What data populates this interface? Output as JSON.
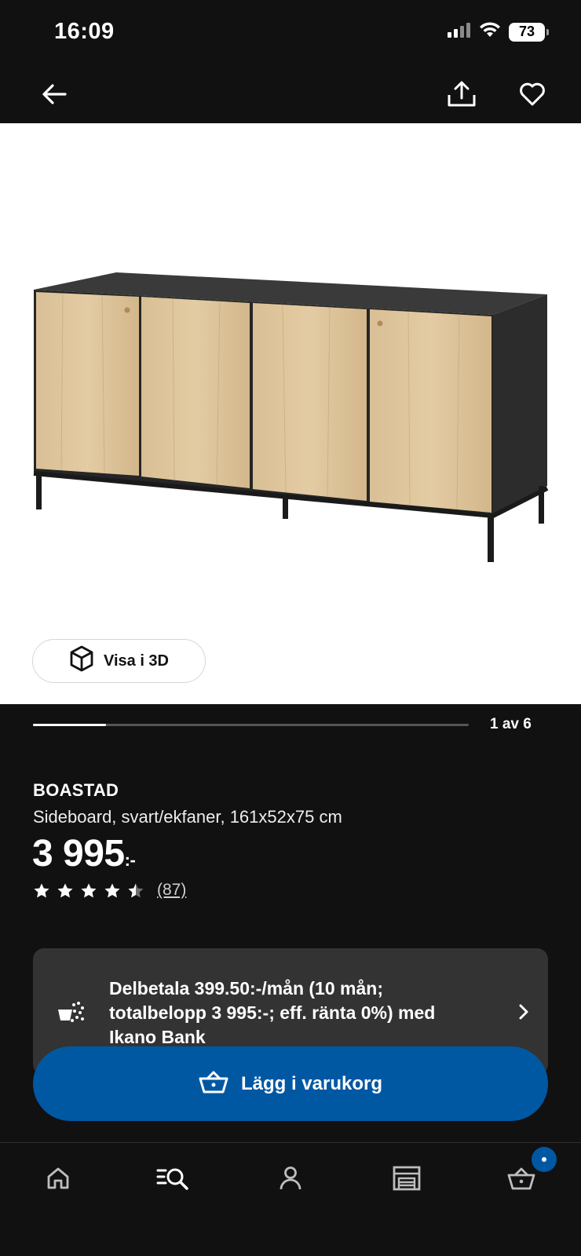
{
  "status_bar": {
    "time": "16:09",
    "battery": "73",
    "icons": [
      "cellular-signal-icon",
      "wifi-icon",
      "battery-icon"
    ]
  },
  "top_nav": {
    "icons": [
      "back-arrow-icon",
      "share-icon",
      "heart-icon"
    ]
  },
  "product_image": {
    "view_3d_label": "Visa i 3D"
  },
  "carousel": {
    "counter": "1 av 6",
    "current": 1,
    "total": 6
  },
  "product": {
    "name": "BOASTAD",
    "description": "Sideboard, svart/ekfaner, 161x52x75 cm",
    "price": "3 995",
    "price_suffix": ":-",
    "rating": 4.5,
    "review_count": "(87)"
  },
  "financing": {
    "text": "Delbetala 399.50:-/mån (10 mån; totalbelopp 3 995:-; eff. ränta 0%) med Ikano Bank"
  },
  "cta": {
    "add_to_cart": "Lägg i varukorg"
  },
  "bottom_nav": {
    "tabs": [
      "home",
      "search",
      "profile",
      "store",
      "cart"
    ],
    "cart_badge": "•"
  },
  "colors": {
    "background": "#111111",
    "primary_blue": "#0058a3",
    "card": "#333333",
    "image_bg": "#ffffff"
  }
}
